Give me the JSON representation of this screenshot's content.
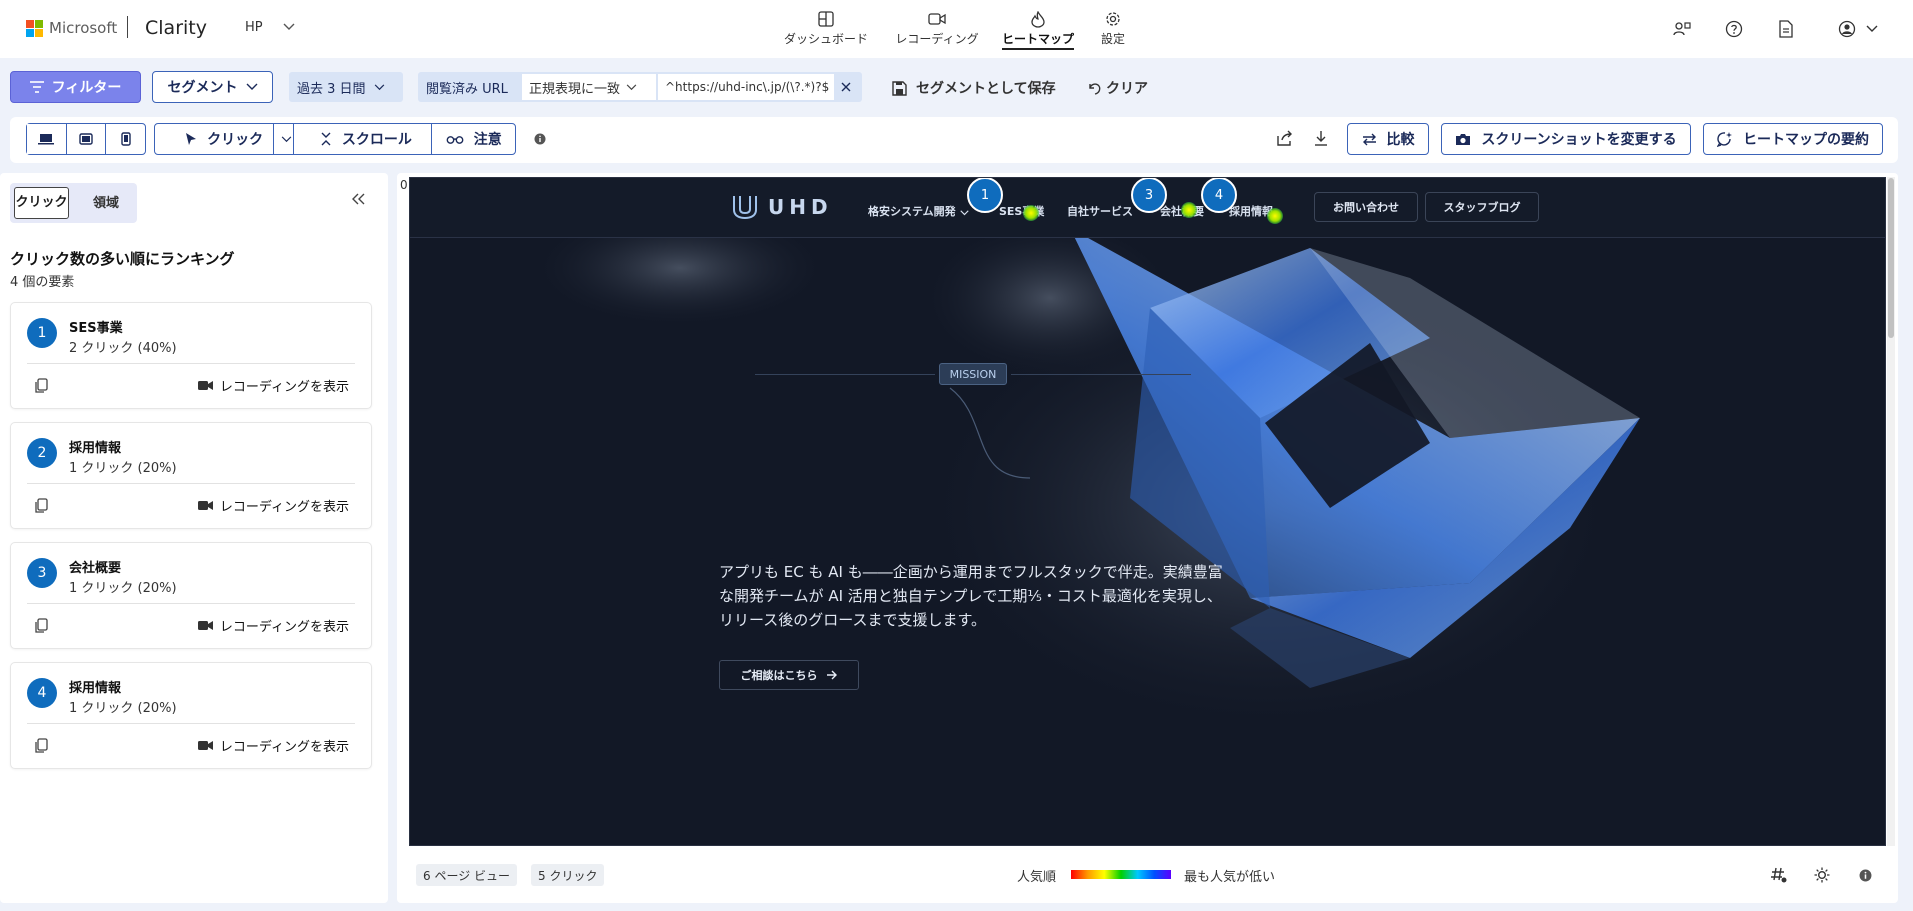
{
  "header": {
    "brand": "Microsoft",
    "app_name": "Clarity",
    "project": "HP",
    "nav": [
      {
        "label": "ダッシュボード",
        "icon": "dashboard-icon"
      },
      {
        "label": "レコーディング",
        "icon": "video-icon"
      },
      {
        "label": "ヒートマップ",
        "icon": "flame-icon",
        "active": true
      },
      {
        "label": "設定",
        "icon": "gear-icon"
      }
    ]
  },
  "filterbar": {
    "filter_label": "フィルター",
    "segment_label": "セグメント",
    "date_range": "過去 3 日間",
    "url_chip_label": "閲覧済み URL",
    "match_mode": "正規表現に一致",
    "url_value": "^https://uhd-inc\\.jp/(\\?.*)?$",
    "save_segment": "セグメントとして保存",
    "clear": "クリア"
  },
  "toolbar": {
    "mode_click": "クリック",
    "mode_scroll": "スクロール",
    "mode_attention": "注意",
    "compare": "比較",
    "change_screenshot": "スクリーンショットを変更する",
    "summary": "ヒートマップの要約"
  },
  "leftpanel": {
    "toggle_click": "クリック",
    "toggle_area": "領域",
    "title": "クリック数の多い順にランキング",
    "subtitle": "4 個の要素",
    "recording_label": "レコーディングを表示",
    "items": [
      {
        "rank": "1",
        "name": "SES事業",
        "clicks": "2 クリック (40%)"
      },
      {
        "rank": "2",
        "name": "採用情報",
        "clicks": "1 クリック (20%)"
      },
      {
        "rank": "3",
        "name": "会社概要",
        "clicks": "1 クリック (20%)"
      },
      {
        "rank": "4",
        "name": "採用情報",
        "clicks": "1 クリック (20%)"
      }
    ]
  },
  "heatmap": {
    "scroll_top": "0",
    "site": {
      "logo_text": "UHD",
      "nav": [
        "格安システム開発",
        "SES事業",
        "自社サービス",
        "会社概要",
        "採用情報"
      ],
      "contact": "お問い合わせ",
      "blog": "スタッフブログ",
      "mission": "MISSION",
      "hero_text": "アプリも EC も AI も――企画から運用までフルスタックで伴走。実績豊富な開発チームが AI 活用と独自テンプレで工期⅕・コスト最適化を実現し、リリース後のグロースまで支援します。",
      "cta": "ご相談はこちら"
    },
    "markers": [
      "1",
      "3",
      "4"
    ]
  },
  "bottombar": {
    "page_views": "6 ページ ビュー",
    "clicks": "5 クリック",
    "legend_popular": "人気順",
    "legend_least": "最も人気が低い"
  },
  "colors": {
    "accent": "#0f6cbd",
    "filter_button": "#7b83eb",
    "border_blue": "#3b63b8",
    "site_bg": "#121826"
  }
}
